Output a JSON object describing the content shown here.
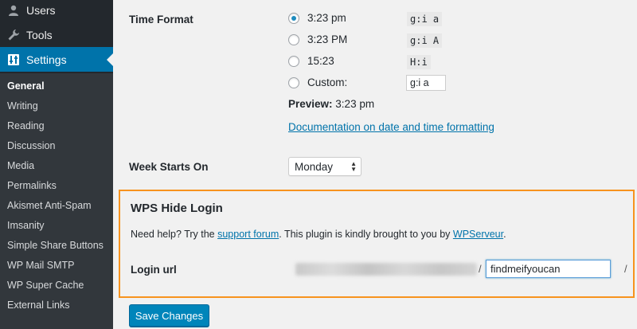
{
  "sidebar": {
    "top_items": [
      {
        "label": "Users",
        "icon": "users-icon"
      },
      {
        "label": "Tools",
        "icon": "wrench-icon"
      },
      {
        "label": "Settings",
        "icon": "settings-icon",
        "active": true
      }
    ],
    "submenu": [
      "General",
      "Writing",
      "Reading",
      "Discussion",
      "Media",
      "Permalinks",
      "Akismet Anti-Spam",
      "Imsanity",
      "Simple Share Buttons",
      "WP Mail SMTP",
      "WP Super Cache",
      "External Links"
    ],
    "current_submenu": "General"
  },
  "time_format": {
    "label": "Time Format",
    "options": [
      {
        "label": "3:23 pm",
        "code": "g:i a",
        "checked": true
      },
      {
        "label": "3:23 PM",
        "code": "g:i A",
        "checked": false
      },
      {
        "label": "15:23",
        "code": "H:i",
        "checked": false
      },
      {
        "label": "Custom:",
        "checked": false
      }
    ],
    "custom_value": "g:i a",
    "preview_label": "Preview:",
    "preview_value": "3:23 pm",
    "doc_link": "Documentation on date and time formatting"
  },
  "week_starts": {
    "label": "Week Starts On",
    "value": "Monday"
  },
  "plugin": {
    "title": "WPS Hide Login",
    "help_prefix": "Need help? Try the",
    "support_link": "support forum",
    "help_middle": ". This plugin is kindly brought to you by",
    "author_link": "WPServeur",
    "help_suffix": ".",
    "login_label": "Login url",
    "login_value": "findmeifyoucan",
    "slash": "/",
    "highlight_color": "#f7931e"
  },
  "save_button": "Save Changes"
}
